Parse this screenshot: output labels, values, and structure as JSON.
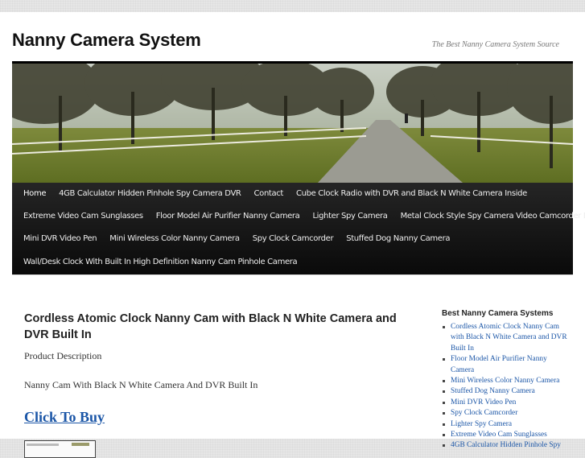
{
  "site": {
    "title": "Nanny Camera System",
    "tagline": "The Best Nanny Camera System Source"
  },
  "menu": {
    "rows": [
      [
        "Home",
        "4GB Calculator Hidden Pinhole Spy Camera DVR",
        "Contact",
        "Cube Clock Radio with DVR and Black N White Camera Inside"
      ],
      [
        "Extreme Video Cam Sunglasses",
        "Floor Model Air Purifier Nanny Camera",
        "Lighter Spy Camera",
        "Metal Clock Style Spy Camera Video Camcorder DVR"
      ],
      [
        "Mini DVR Video Pen",
        "Mini Wireless Color Nanny Camera",
        "Spy Clock Camcorder",
        "Stuffed Dog Nanny Camera"
      ],
      [
        "Wall/Desk Clock With Built In High Definition Nanny Cam Pinhole Camera"
      ]
    ],
    "current": "Home"
  },
  "post": {
    "title": "Cordless Atomic Clock Nanny Cam with Black N White Camera and DVR Built In",
    "product_description": "Product Description",
    "description_text": "Nanny Cam With Black N White Camera And DVR Built In",
    "buy_link": "Click To Buy"
  },
  "sidebar": {
    "widget_title": "Best Nanny Camera Systems",
    "items": [
      "Cordless Atomic Clock Nanny Cam with Black N White Camera and DVR Built In",
      "Floor Model Air Purifier Nanny Camera",
      "Mini Wireless Color Nanny Camera",
      "Stuffed Dog Nanny Camera",
      "Mini DVR Video Pen",
      "Spy Clock Camcorder",
      "Lighter Spy Camera",
      "Extreme Video Cam Sunglasses",
      "4GB Calculator Hidden Pinhole Spy"
    ]
  },
  "colors": {
    "link": "#1b56a7",
    "menu_bg": "#111111",
    "menu_text": "#eeeeee",
    "header_rule": "#000000"
  }
}
